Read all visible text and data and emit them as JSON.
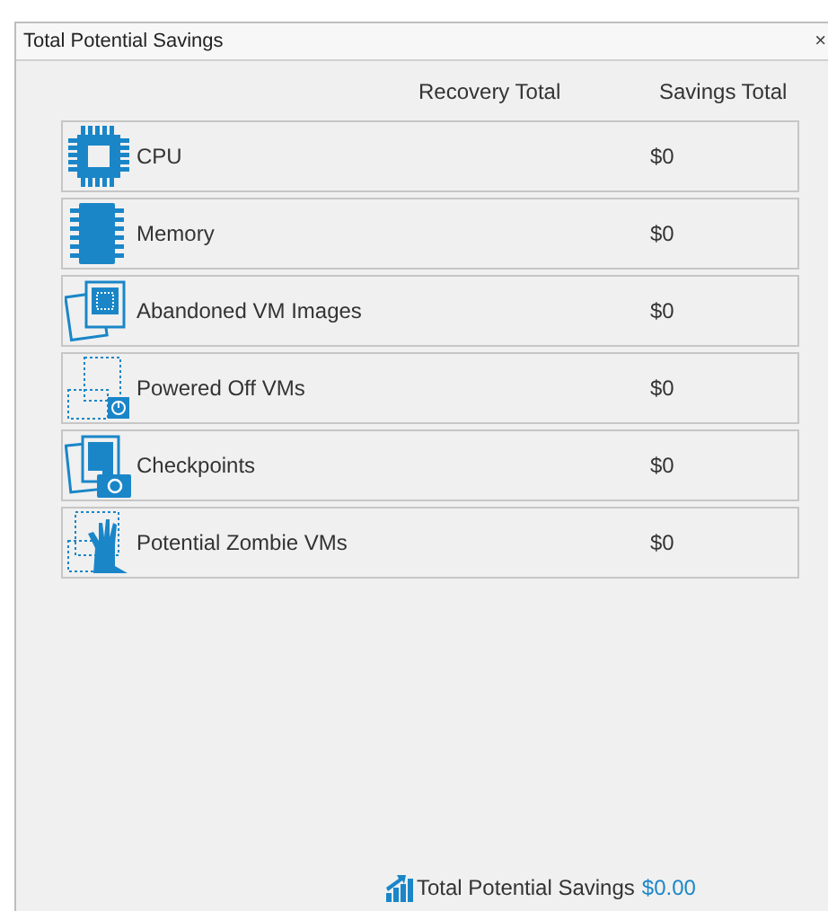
{
  "window": {
    "title": "Total Potential Savings",
    "close": "×"
  },
  "columns": [
    "Recovery Total",
    "Savings Total"
  ],
  "rows": [
    {
      "kind": "cpu",
      "label": "CPU",
      "savings": "$0"
    },
    {
      "kind": "memory",
      "label": "Memory",
      "savings": "$0"
    },
    {
      "kind": "images",
      "label": "Abandoned VM Images",
      "savings": "$0"
    },
    {
      "kind": "powered-off",
      "label": "Powered Off VMs",
      "savings": "$0"
    },
    {
      "kind": "checkpoints",
      "label": "Checkpoints",
      "savings": "$0"
    },
    {
      "kind": "zombie",
      "label": "Potential Zombie VMs",
      "savings": "$0"
    }
  ],
  "footer": {
    "label": "Total Potential Savings",
    "value": "$0.00"
  }
}
